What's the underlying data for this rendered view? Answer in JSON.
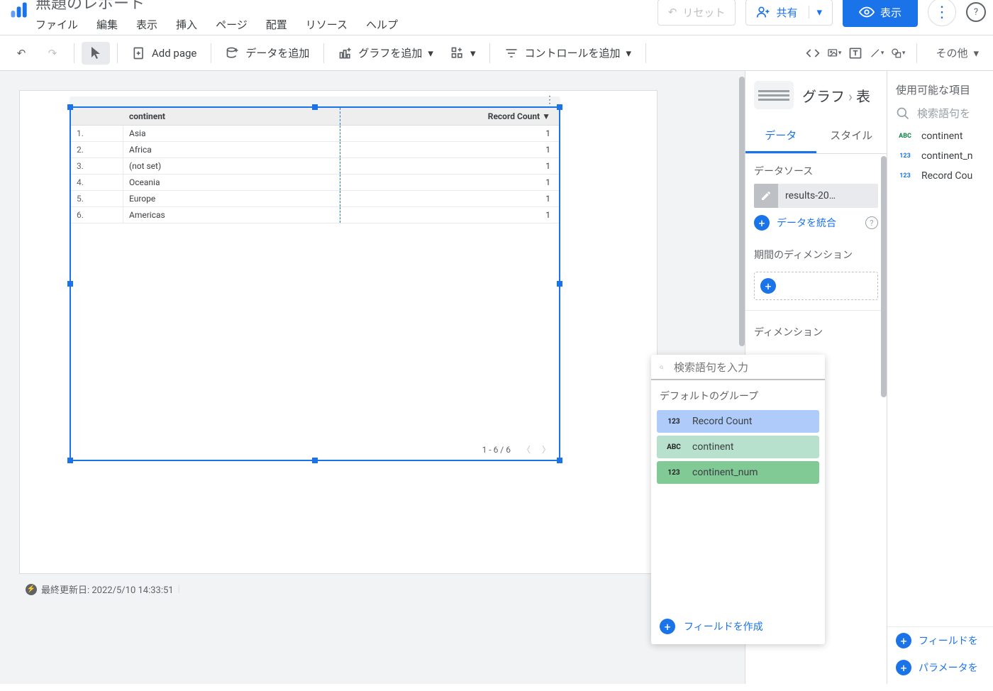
{
  "header": {
    "title": "無題のレポート",
    "menus": [
      "ファイル",
      "編集",
      "表示",
      "挿入",
      "ページ",
      "配置",
      "リソース",
      "ヘルプ"
    ],
    "reset": "リセット",
    "share": "共有",
    "view": "表示"
  },
  "toolbar": {
    "add_page": "Add page",
    "add_data": "データを追加",
    "add_chart": "グラフを追加",
    "add_control": "コントロールを追加",
    "other": "その他"
  },
  "chart": {
    "header_dim": "continent",
    "header_metric": "Record Count",
    "rows": [
      {
        "n": "1.",
        "dim": "Asia",
        "val": "1"
      },
      {
        "n": "2.",
        "dim": "Africa",
        "val": "1"
      },
      {
        "n": "3.",
        "dim": "(not set)",
        "val": "1"
      },
      {
        "n": "4.",
        "dim": "Oceania",
        "val": "1"
      },
      {
        "n": "5.",
        "dim": "Europe",
        "val": "1"
      },
      {
        "n": "6.",
        "dim": "Americas",
        "val": "1"
      }
    ],
    "footer_range": "1 - 6 / 6"
  },
  "status": {
    "updated": "最終更新日: 2022/5/10 14:33:51"
  },
  "panel": {
    "crumb_chart": "グラフ",
    "crumb_table": "表",
    "tab_data": "データ",
    "tab_style": "スタイル",
    "section_ds": "データソース",
    "ds_name": "results-20…",
    "blend": "データを統合",
    "section_daterange": "期間のディメンション",
    "section_dim": "ディメンション"
  },
  "fields": {
    "header": "使用可能な項目",
    "search_ph": "検索語句を",
    "list": [
      {
        "type": "ABC",
        "cls": "type-abc",
        "name": "continent"
      },
      {
        "type": "123",
        "cls": "type-123",
        "name": "continent_n"
      },
      {
        "type": "123",
        "cls": "type-123",
        "name": "Record Cou"
      }
    ],
    "create_field": "フィールドを",
    "create_param": "パラメータを"
  },
  "picker": {
    "search_ph": "検索語句を入力",
    "group": "デフォルトのグループ",
    "options": [
      {
        "type": "123",
        "name": "Record Count",
        "cls": "blue"
      },
      {
        "type": "ABC",
        "name": "continent",
        "cls": "green-l"
      },
      {
        "type": "123",
        "name": "continent_num",
        "cls": "green"
      }
    ],
    "create": "フィールドを作成"
  }
}
